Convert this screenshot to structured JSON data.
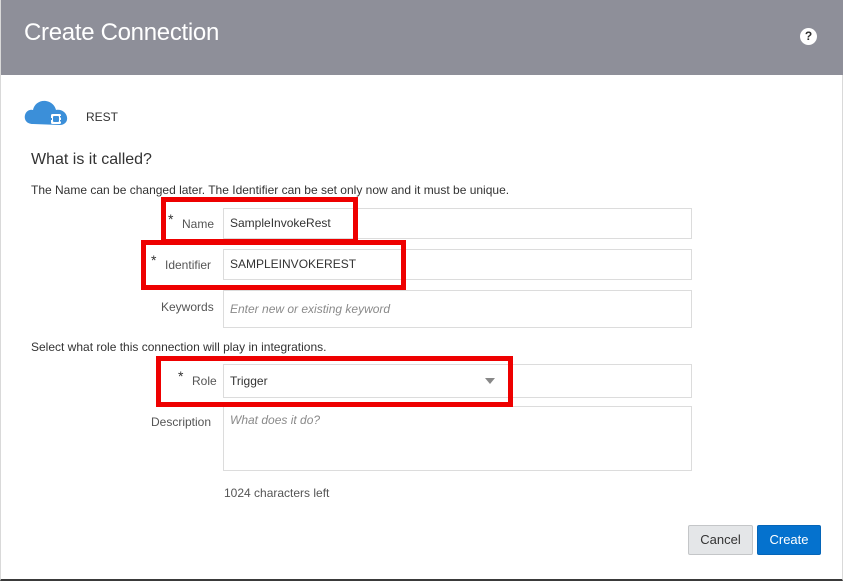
{
  "dialog": {
    "title": "Create Connection",
    "help_label": "?"
  },
  "adapter": {
    "name": "REST",
    "icon": "cloud-plug-icon"
  },
  "section": {
    "heading": "What is it called?",
    "hint_name": "The Name can be changed later. The Identifier can be set only now and it must be unique.",
    "hint_role": "Select what role this connection will play in integrations."
  },
  "fields": {
    "required_marker": "*",
    "name": {
      "label": "Name",
      "value": "SampleInvokeRest",
      "required": true
    },
    "identifier": {
      "label": "Identifier",
      "value": "SAMPLEINVOKEREST",
      "required": true
    },
    "keywords": {
      "label": "Keywords",
      "placeholder": "Enter new or existing keyword"
    },
    "role": {
      "label": "Role",
      "value": "Trigger",
      "required": true
    },
    "description": {
      "label": "Description",
      "placeholder": "What does it do?"
    },
    "chars_left": "1024 characters left"
  },
  "buttons": {
    "cancel": "Cancel",
    "create": "Create"
  },
  "colors": {
    "header_bg": "#8e8f99",
    "primary": "#0572ce",
    "highlight": "#ee0000",
    "cloud_icon": "#3b8fd9"
  }
}
